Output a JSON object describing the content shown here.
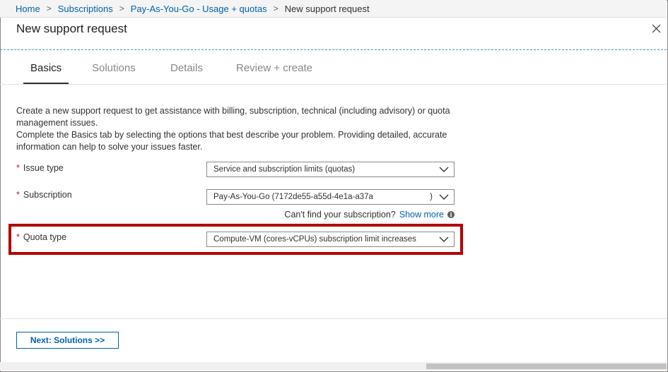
{
  "breadcrumb": {
    "items": [
      "Home",
      "Subscriptions",
      "Pay-As-You-Go - Usage + quotas"
    ],
    "current": "New support request",
    "separator": ">"
  },
  "blade": {
    "title": "New support request",
    "close_icon": "close-icon"
  },
  "tabs": [
    {
      "label": "Basics",
      "active": true
    },
    {
      "label": "Solutions",
      "active": false
    },
    {
      "label": "Details",
      "active": false
    },
    {
      "label": "Review + create",
      "active": false
    }
  ],
  "intro": {
    "line1": "Create a new support request to get assistance with billing, subscription, technical (including advisory) or quota management issues.",
    "line2": "Complete the Basics tab by selecting the options that best describe your problem. Providing detailed, accurate information can help to solve your issues faster."
  },
  "form": {
    "required_marker": "*",
    "issue_type": {
      "label": "Issue type",
      "value": "Service and subscription limits (quotas)"
    },
    "subscription": {
      "label": "Subscription",
      "value": "Pay-As-You-Go (7172de55-a55d-4e1a-a37a",
      "suffix": ")"
    },
    "subscription_hint": {
      "text": "Can't find your subscription?",
      "link": "Show more",
      "icon": "info-icon"
    },
    "quota_type": {
      "label": "Quota type",
      "value": "Compute-VM (cores-vCPUs) subscription limit increases"
    }
  },
  "footer": {
    "next_label": "Next: Solutions >>"
  },
  "colors": {
    "link": "#0062ad",
    "highlight": "#b30000",
    "required": "#a4262c"
  }
}
